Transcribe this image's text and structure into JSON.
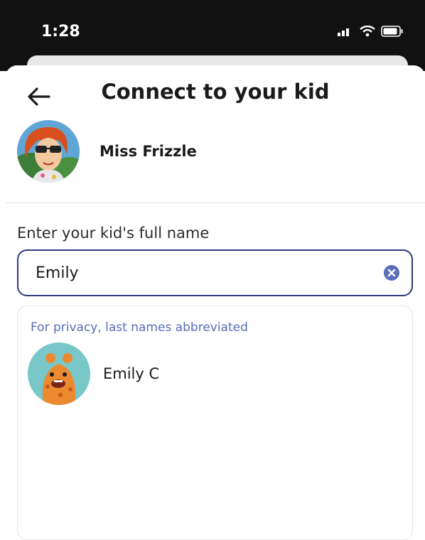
{
  "status": {
    "time": "1:28",
    "icons": [
      "signal-icon",
      "wifi-icon",
      "battery-icon"
    ]
  },
  "header": {
    "title": "Connect to your kid",
    "back_icon": "arrow-left-icon"
  },
  "teacher": {
    "name": "Miss Frizzle"
  },
  "form": {
    "label": "Enter your kid's full name",
    "value": "Emily",
    "clear_icon": "clear-icon"
  },
  "results": {
    "note": "For privacy, last names abbreviated",
    "items": [
      {
        "name": "Emily C"
      }
    ]
  },
  "colors": {
    "accent": "#2e3a82",
    "note": "#5a6cb8",
    "status_bar": "#111111"
  }
}
